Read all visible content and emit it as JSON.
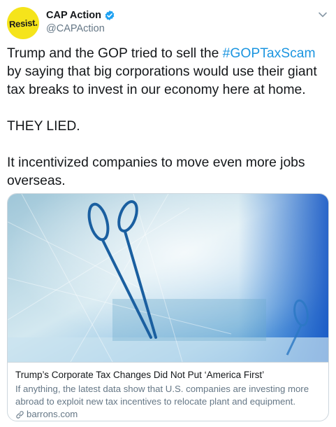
{
  "author": {
    "avatar_text": "Resist.",
    "display_name": "CAP Action",
    "handle": "@CAPAction",
    "verified": true
  },
  "tweet": {
    "text_part1": "Trump and the GOP tried to sell the ",
    "hashtag": "#GOPTaxScam",
    "text_part2": " by saying that big corporations would use their giant tax breaks to invest in our economy here at home.\n\nTHEY LIED.\n\nIt incentivized companies to move even more jobs overseas."
  },
  "card": {
    "title": "Trump’s Corporate Tax Changes Did Not Put ‘America First’",
    "description": "If anything, the latest data show that U.S. companies are investing more abroad to exploit new tax incentives to relocate plant and equipment.",
    "domain": "barrons.com"
  },
  "colors": {
    "hashtag": "#1b95e0",
    "verified": "#1da1f2",
    "avatar_bg": "#f5e41b",
    "secondary_text": "#657786"
  },
  "icons": [
    "verified-badge-icon",
    "chevron-down-icon",
    "link-icon"
  ]
}
